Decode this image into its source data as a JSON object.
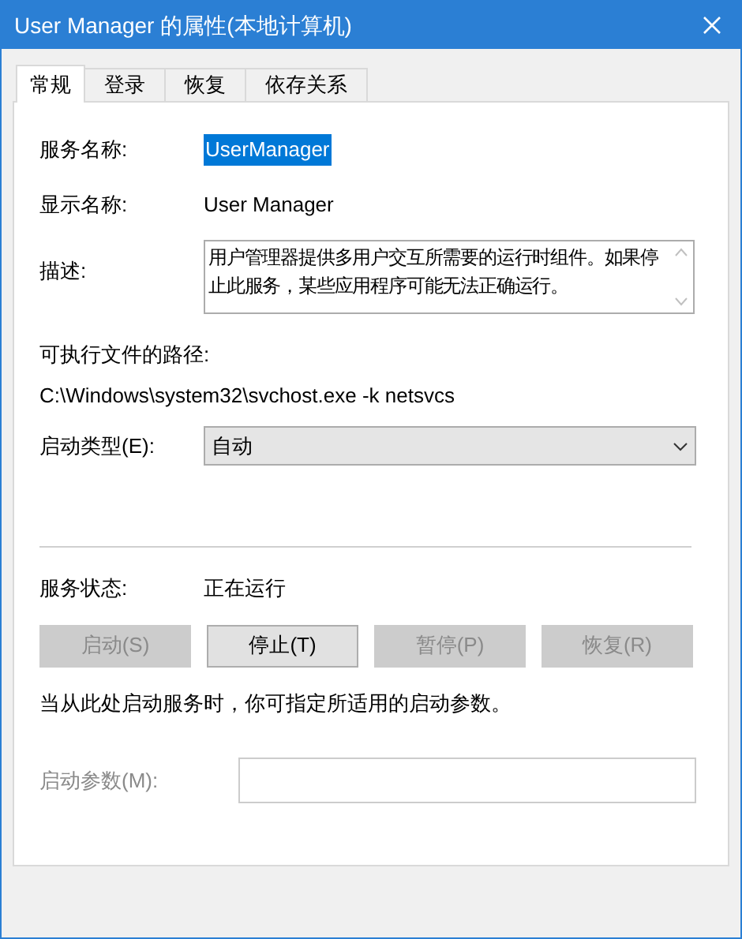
{
  "window": {
    "title": "User Manager 的属性(本地计算机)"
  },
  "tabs": [
    {
      "label": "常规",
      "selected": true
    },
    {
      "label": "登录",
      "selected": false
    },
    {
      "label": "恢复",
      "selected": false
    },
    {
      "label": "依存关系",
      "selected": false
    }
  ],
  "service_name": {
    "label": "服务名称:",
    "value": "UserManager",
    "selected": true
  },
  "display_name": {
    "label": "显示名称:",
    "value": "User Manager"
  },
  "description": {
    "label": "描述:",
    "value": "用户管理器提供多用户交互所需要的运行时组件。如果停止此服务，某些应用程序可能无法正确运行。"
  },
  "executable_path": {
    "label": "可执行文件的路径:",
    "value": "C:\\Windows\\system32\\svchost.exe -k netsvcs"
  },
  "startup_type": {
    "label": "启动类型(E):",
    "value": "自动"
  },
  "service_status": {
    "label": "服务状态:",
    "value": "正在运行"
  },
  "buttons": [
    {
      "label": "启动(S)",
      "disabled": true
    },
    {
      "label": "停止(T)",
      "disabled": false
    },
    {
      "label": "暂停(P)",
      "disabled": true
    },
    {
      "label": "恢复(R)",
      "disabled": true
    }
  ],
  "note": "当从此处启动服务时，你可指定所适用的启动参数。",
  "start_parameters": {
    "label": "启动参数(M):",
    "disabled": true
  }
}
